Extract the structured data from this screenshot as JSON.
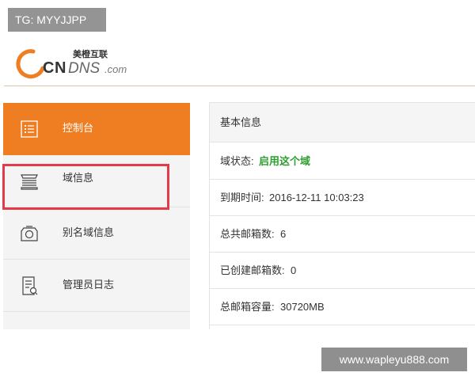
{
  "watermark": {
    "top": "TG: MYYJJPP",
    "bottom": "www.wapleyu888.com"
  },
  "logo": {
    "cn": "美橙互联",
    "brand_c": "C",
    "brand_n": "N",
    "brand_dns": "DNS",
    "brand_com": ".com"
  },
  "sidebar": {
    "items": [
      {
        "label": "控制台",
        "icon": "list-icon"
      },
      {
        "label": "域信息",
        "icon": "stack-icon"
      },
      {
        "label": "别名域信息",
        "icon": "alias-icon"
      },
      {
        "label": "管理员日志",
        "icon": "log-icon"
      }
    ]
  },
  "panel": {
    "title": "基本信息",
    "rows": [
      {
        "key": "域状态:",
        "value": "启用这个域"
      },
      {
        "key": "到期时间:",
        "value": "2016-12-11 10:03:23"
      },
      {
        "key": "总共邮箱数:",
        "value": "6"
      },
      {
        "key": "已创建邮箱数:",
        "value": "0"
      },
      {
        "key": "总邮箱容量:",
        "value": "30720MB"
      }
    ]
  },
  "colors": {
    "accent": "#ef7e23",
    "highlight": "#e23c4b",
    "status_ok": "#2e9e2e"
  }
}
